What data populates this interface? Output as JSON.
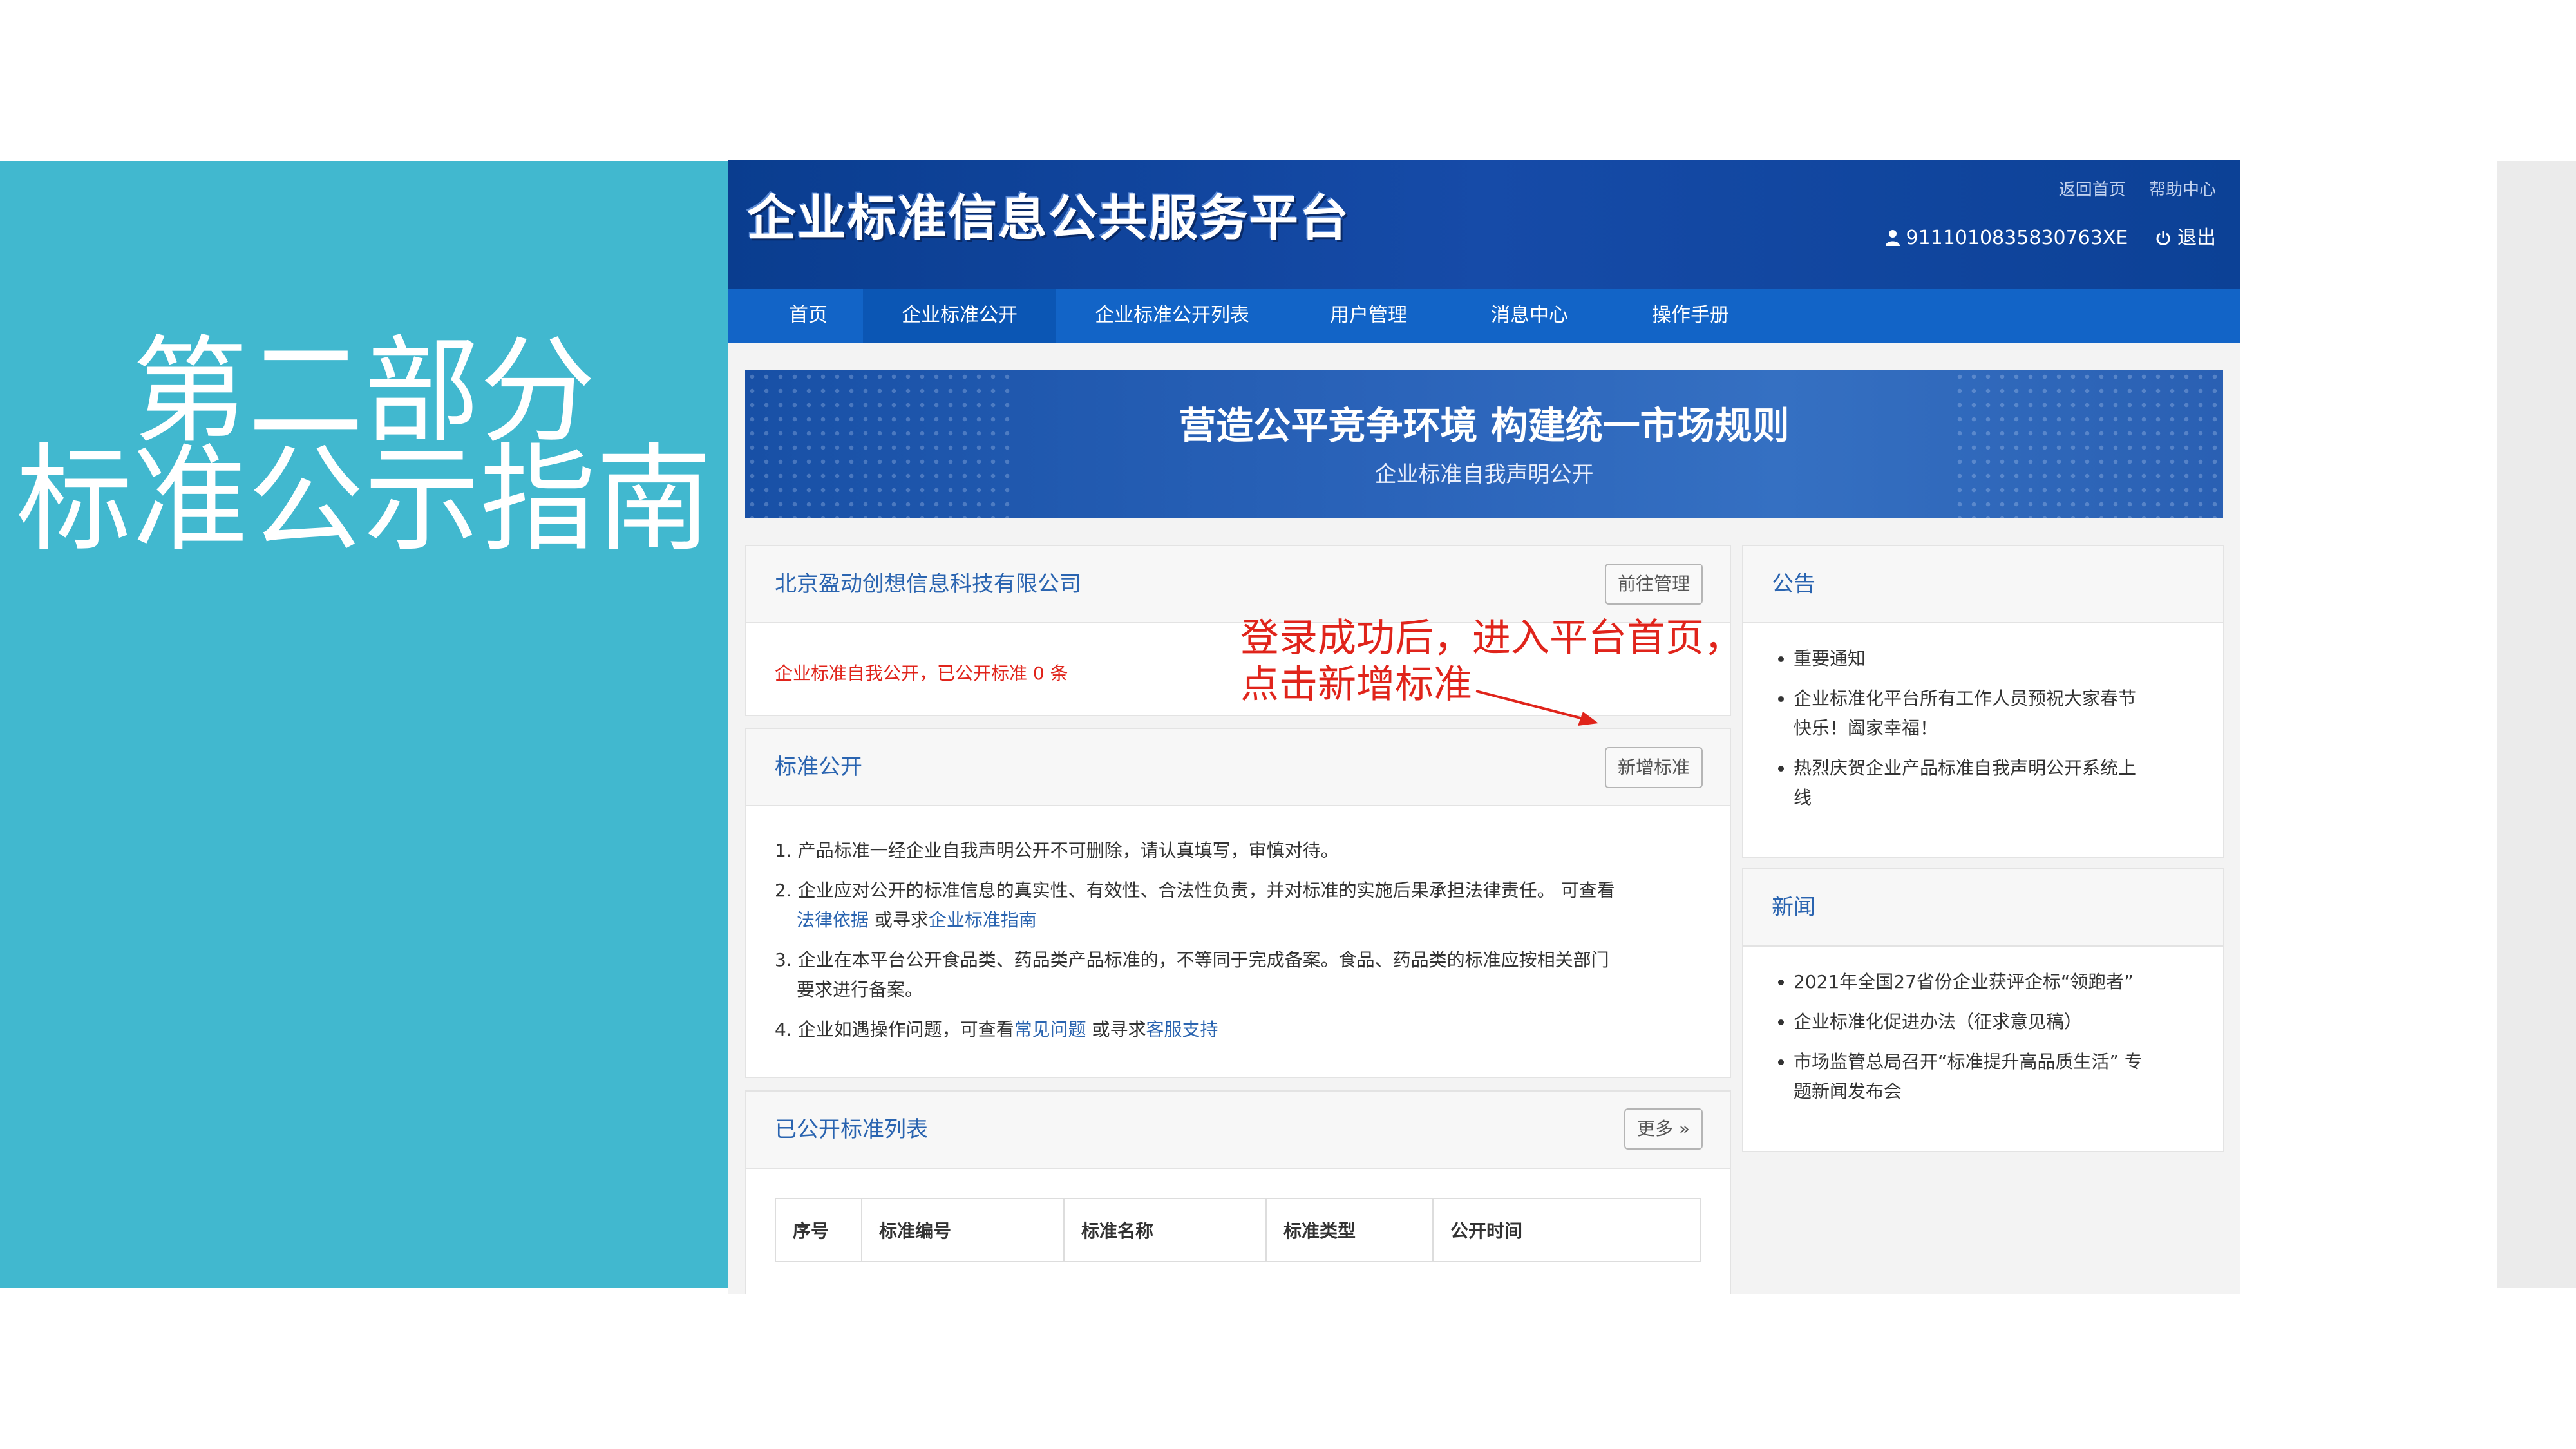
{
  "slide": {
    "title_line1": "第二部分",
    "title_line2": "标准公示指南",
    "accent_color": "#41b8cf"
  },
  "header": {
    "logo_text": "企业标准信息公共服务平台",
    "links": [
      "返回首页",
      "帮助中心"
    ],
    "user_id": "9111010835830763XE",
    "logout_label": "退出",
    "user_icon": "user-icon",
    "logout_icon": "power-icon"
  },
  "nav": {
    "items": [
      "首页",
      "企业标准公开",
      "企业标准公开列表",
      "用户管理",
      "消息中心",
      "操作手册"
    ],
    "active": "企业标准公开"
  },
  "banner": {
    "title": "营造公平竞争环境  构建统一市场规则",
    "subtitle": "企业标准自我声明公开"
  },
  "company_card": {
    "title": "北京盈动创想信息科技有限公司",
    "manage_button": "前往管理",
    "status_text": "企业标准自我公开，已公开标准 0 条"
  },
  "standard_card": {
    "title": "标准公开",
    "add_button": "新增标准",
    "instructions": {
      "line1": "1. 产品标准一经企业自我声明公开不可删除，请认真填写，审慎对待。",
      "line2a": "2. 企业应对公开的标准信息的真实性、有效性、合法性负责，并对标准的实施后果承担法律责任。 可查看",
      "line2b_link1": "法律依据",
      "line2b_mid": " 或寻求",
      "line2b_link2": "企业标准指南",
      "line3a": "3. 企业在本平台公开食品类、药品类产品标准的，不等同于完成备案。食品、药品类的标准应按相关部门",
      "line3b": "要求进行备案。",
      "line4a": "4. 企业如遇操作问题，可查看",
      "line4_link1": "常见问题",
      "line4_mid": " 或寻求",
      "line4_link2": "客服支持"
    }
  },
  "annotation": {
    "line1": "登录成功后，进入平台首页，",
    "line2": "点击新增标准"
  },
  "published_card": {
    "title": "已公开标准列表",
    "more_button": "更多 »",
    "columns": [
      "序号",
      "标准编号",
      "标准名称",
      "标准类型",
      "公开时间"
    ]
  },
  "notice_card": {
    "title": "公告",
    "items": [
      "重要通知",
      "企业标准化平台所有工作人员预祝大家春节",
      "快乐！阖家幸福！",
      "热烈庆贺企业产品标准自我声明公开系统上",
      "线"
    ]
  },
  "news_card": {
    "title": "新闻",
    "items": [
      "2021年全国27省份企业获评企标“领跑者”",
      "企业标准化促进办法（征求意见稿）",
      "市场监管总局召开“标准提升高品质生活” 专",
      "题新闻发布会"
    ]
  }
}
